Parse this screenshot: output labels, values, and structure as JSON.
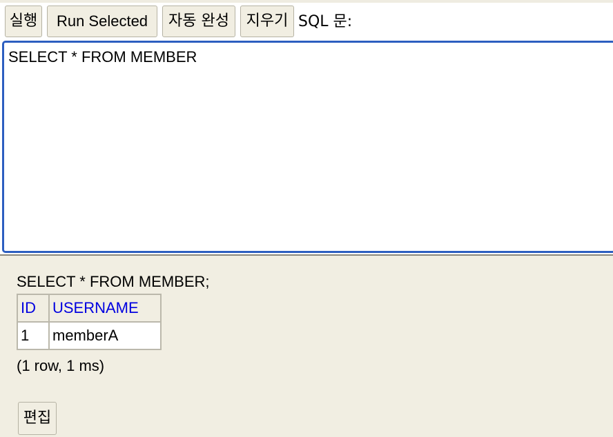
{
  "toolbar": {
    "run_label": "실행",
    "run_selected_label": "Run Selected",
    "autocomplete_label": "자동 완성",
    "clear_label": "지우기",
    "sql_label": "SQL 문:"
  },
  "editor": {
    "value": "SELECT * FROM MEMBER"
  },
  "result": {
    "sql": "SELECT * FROM MEMBER;",
    "columns": [
      "ID",
      "USERNAME"
    ],
    "rows": [
      [
        "1",
        "memberA"
      ]
    ],
    "info": "(1 row, 1 ms)",
    "edit_label": "편집"
  },
  "colors": {
    "editor_border": "#2c5ec0",
    "pane_background": "#f1eee2",
    "header_text": "#0000e0"
  }
}
